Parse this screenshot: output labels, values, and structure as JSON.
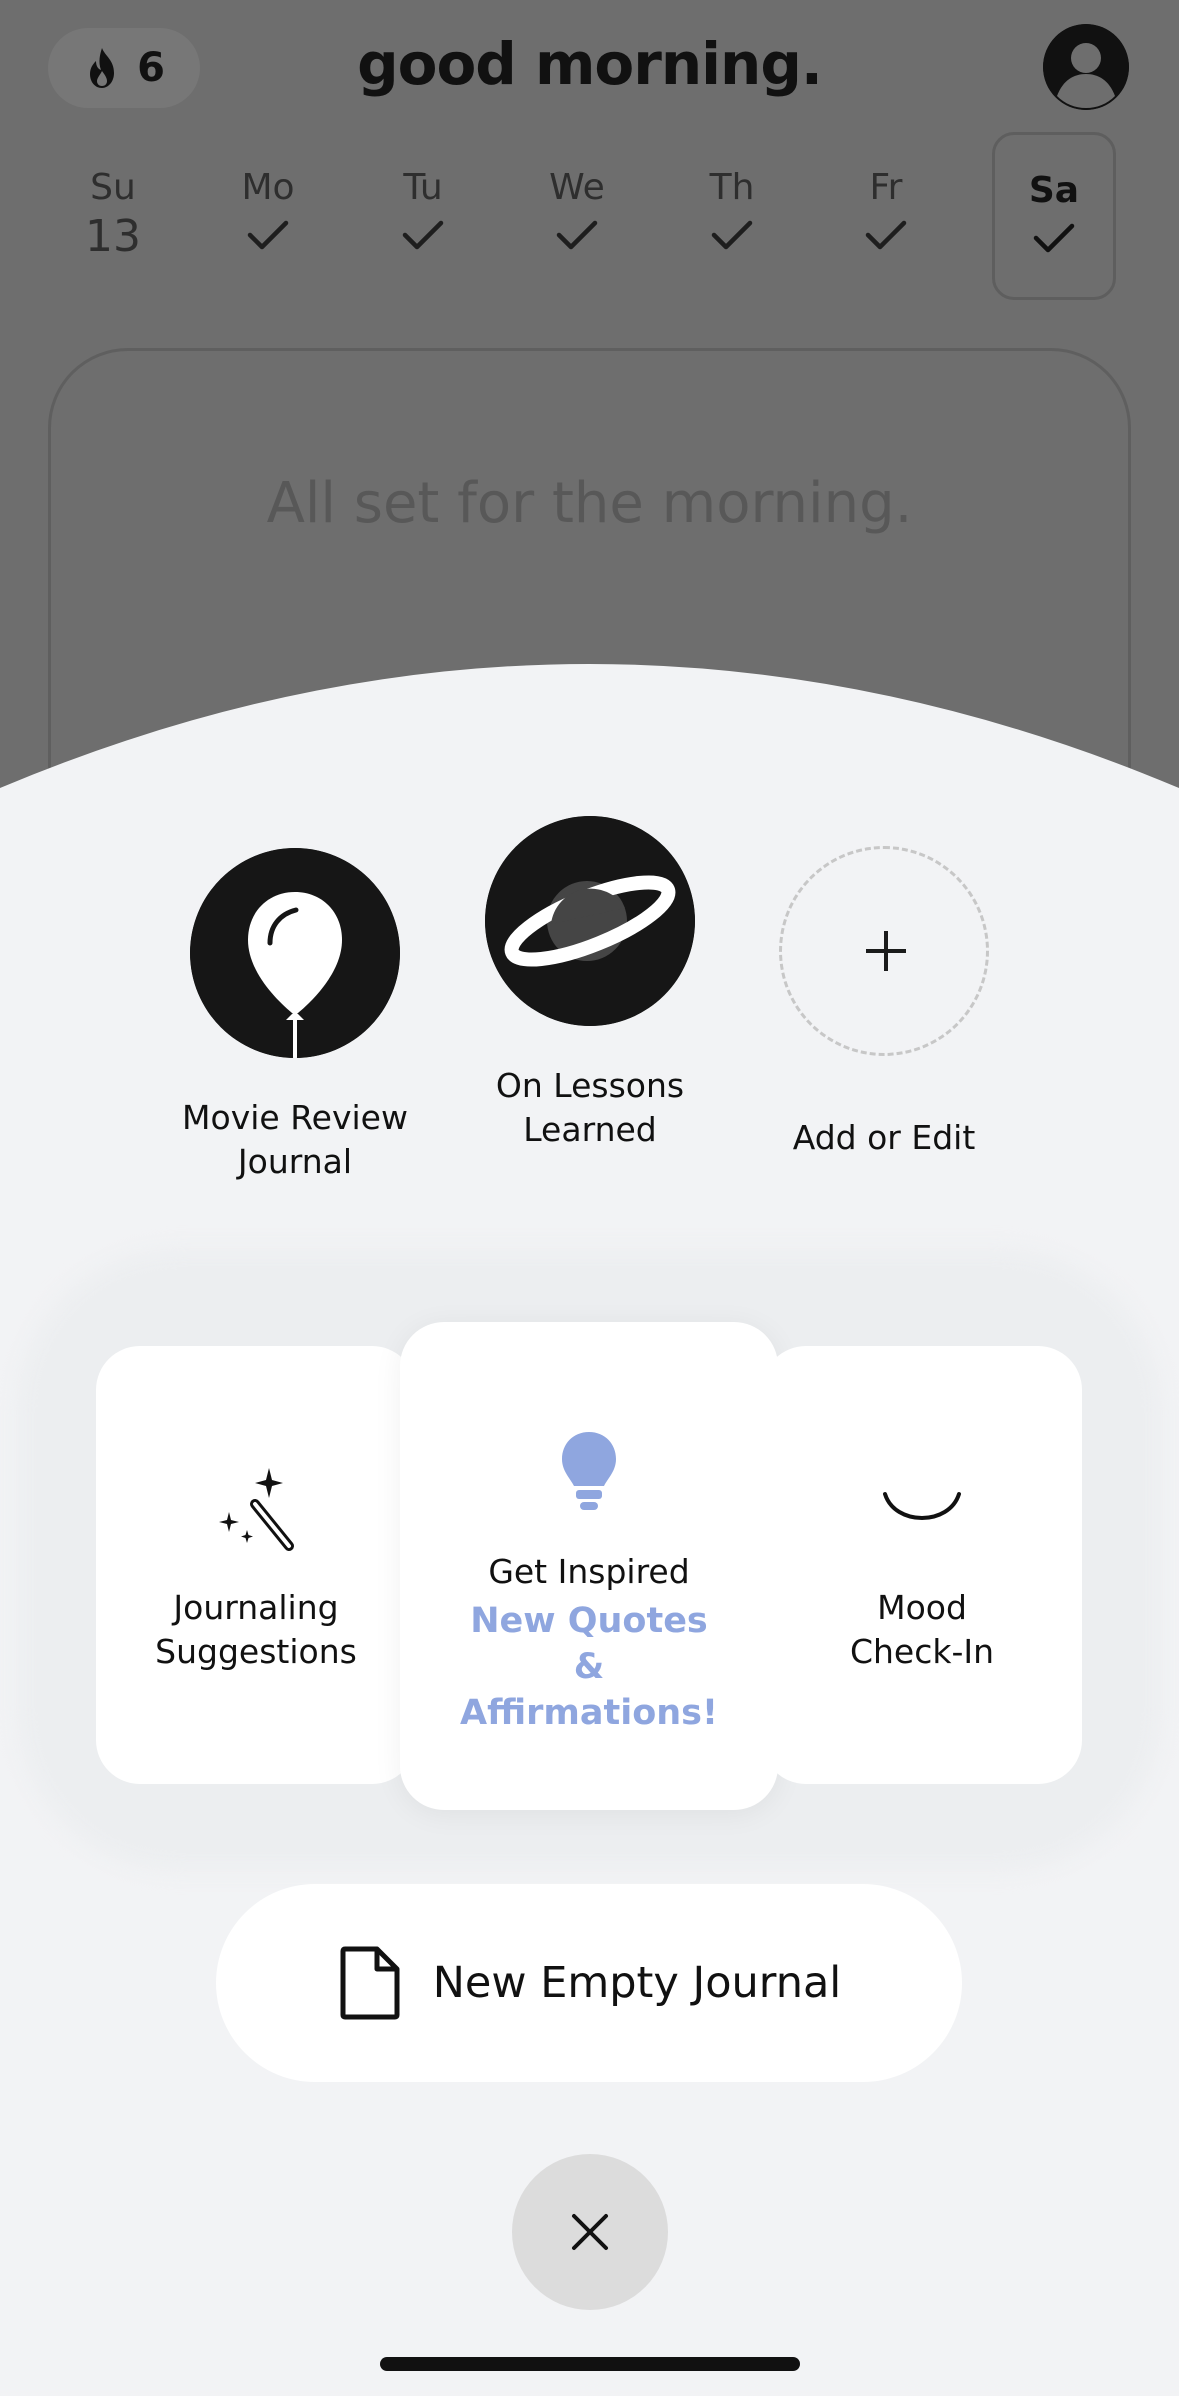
{
  "header": {
    "streak_count": "6",
    "greeting": "good morning."
  },
  "week": [
    {
      "name": "Su",
      "value": "13",
      "type": "number",
      "active": false
    },
    {
      "name": "Mo",
      "type": "check",
      "active": false
    },
    {
      "name": "Tu",
      "type": "check",
      "active": false
    },
    {
      "name": "We",
      "type": "check",
      "active": false
    },
    {
      "name": "Th",
      "type": "check",
      "active": false
    },
    {
      "name": "Fr",
      "type": "check",
      "active": false
    },
    {
      "name": "Sa",
      "type": "check",
      "active": true
    }
  ],
  "morning_card": {
    "text": "All set for the morning."
  },
  "shortcuts": [
    {
      "label": "Movie Review Journal",
      "icon": "balloon-icon"
    },
    {
      "label": "On Lessons Learned",
      "icon": "planet-icon"
    },
    {
      "label": "Add or Edit",
      "icon": "plus-icon"
    }
  ],
  "suggestion_cards": {
    "left": {
      "title": "Journaling Suggestions",
      "icon": "magic-wand-icon"
    },
    "center": {
      "title": "Get Inspired",
      "subtitle": "New Quotes & Affirmations!",
      "icon": "lightbulb-icon"
    },
    "right": {
      "title": "Mood Check-In",
      "icon": "smile-icon"
    }
  },
  "new_journal": {
    "label": "New Empty Journal"
  },
  "colors": {
    "accent": "#8fa6df",
    "dim_background": "#6e6e6e",
    "sheet_background": "#f2f3f5"
  }
}
